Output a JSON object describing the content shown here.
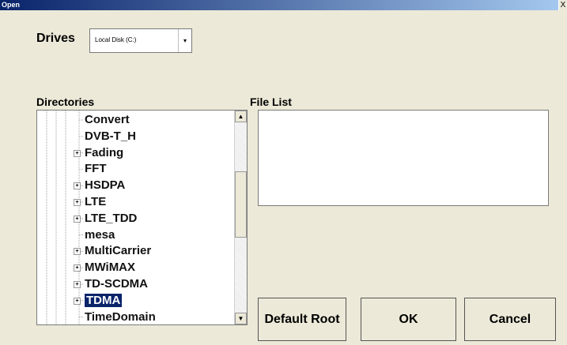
{
  "window": {
    "title": "Open",
    "close_glyph": "X"
  },
  "drives": {
    "label": "Drives",
    "selected": "Local Disk (C:)",
    "arrow": "▾"
  },
  "directories": {
    "label": "Directories",
    "items": [
      {
        "label": "Convert",
        "expandable": false
      },
      {
        "label": "DVB-T_H",
        "expandable": false
      },
      {
        "label": "Fading",
        "expandable": true
      },
      {
        "label": "FFT",
        "expandable": false
      },
      {
        "label": "HSDPA",
        "expandable": true
      },
      {
        "label": "LTE",
        "expandable": true
      },
      {
        "label": "LTE_TDD",
        "expandable": true
      },
      {
        "label": "mesa",
        "expandable": false
      },
      {
        "label": "MultiCarrier",
        "expandable": true
      },
      {
        "label": "MWiMAX",
        "expandable": true
      },
      {
        "label": "TD-SCDMA",
        "expandable": true
      },
      {
        "label": "TDMA",
        "expandable": true,
        "selected": true
      },
      {
        "label": "TimeDomain",
        "expandable": false
      }
    ],
    "scroll_up": "▲",
    "scroll_down": "▼"
  },
  "file_list": {
    "label": "File List"
  },
  "buttons": {
    "default_root": "Default Root",
    "ok": "OK",
    "cancel": "Cancel"
  }
}
